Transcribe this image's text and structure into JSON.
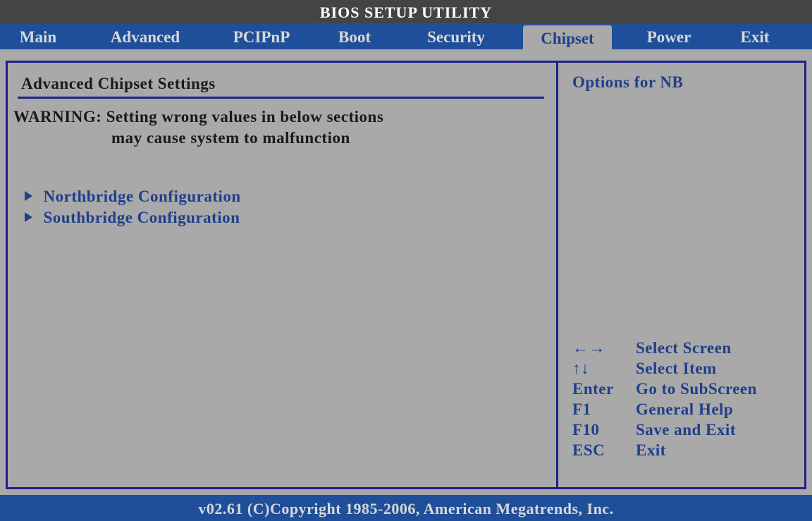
{
  "title": "BIOS SETUP UTILITY",
  "menu": [
    {
      "label": "Main"
    },
    {
      "label": "Advanced"
    },
    {
      "label": "PCIPnP"
    },
    {
      "label": "Boot"
    },
    {
      "label": "Security"
    },
    {
      "label": "Chipset",
      "active": true
    },
    {
      "label": "Power"
    },
    {
      "label": "Exit"
    }
  ],
  "main": {
    "heading": "Advanced Chipset Settings",
    "warning_line1": "WARNING: Setting wrong values in below sections",
    "warning_line2": "may cause system to malfunction",
    "items": [
      {
        "label": "Northbridge Configuration"
      },
      {
        "label": "Southbridge Configuration"
      }
    ]
  },
  "help": {
    "text": "Options for NB",
    "keys": [
      {
        "key": "←→",
        "action": "Select Screen"
      },
      {
        "key": "↑↓",
        "action": "Select Item"
      },
      {
        "key": "Enter",
        "action": "Go to SubScreen"
      },
      {
        "key": "F1",
        "action": "General Help"
      },
      {
        "key": "F10",
        "action": "Save and Exit"
      },
      {
        "key": "ESC",
        "action": "Exit"
      }
    ]
  },
  "footer": "v02.61 (C)Copyright 1985-2006, American Megatrends, Inc.",
  "colors": {
    "background": "#a9a9a9",
    "menu_bar": "#1f4f9a",
    "title_bar": "#444444",
    "frame": "#1f1f8c",
    "highlight_text": "#1f3f8a"
  }
}
